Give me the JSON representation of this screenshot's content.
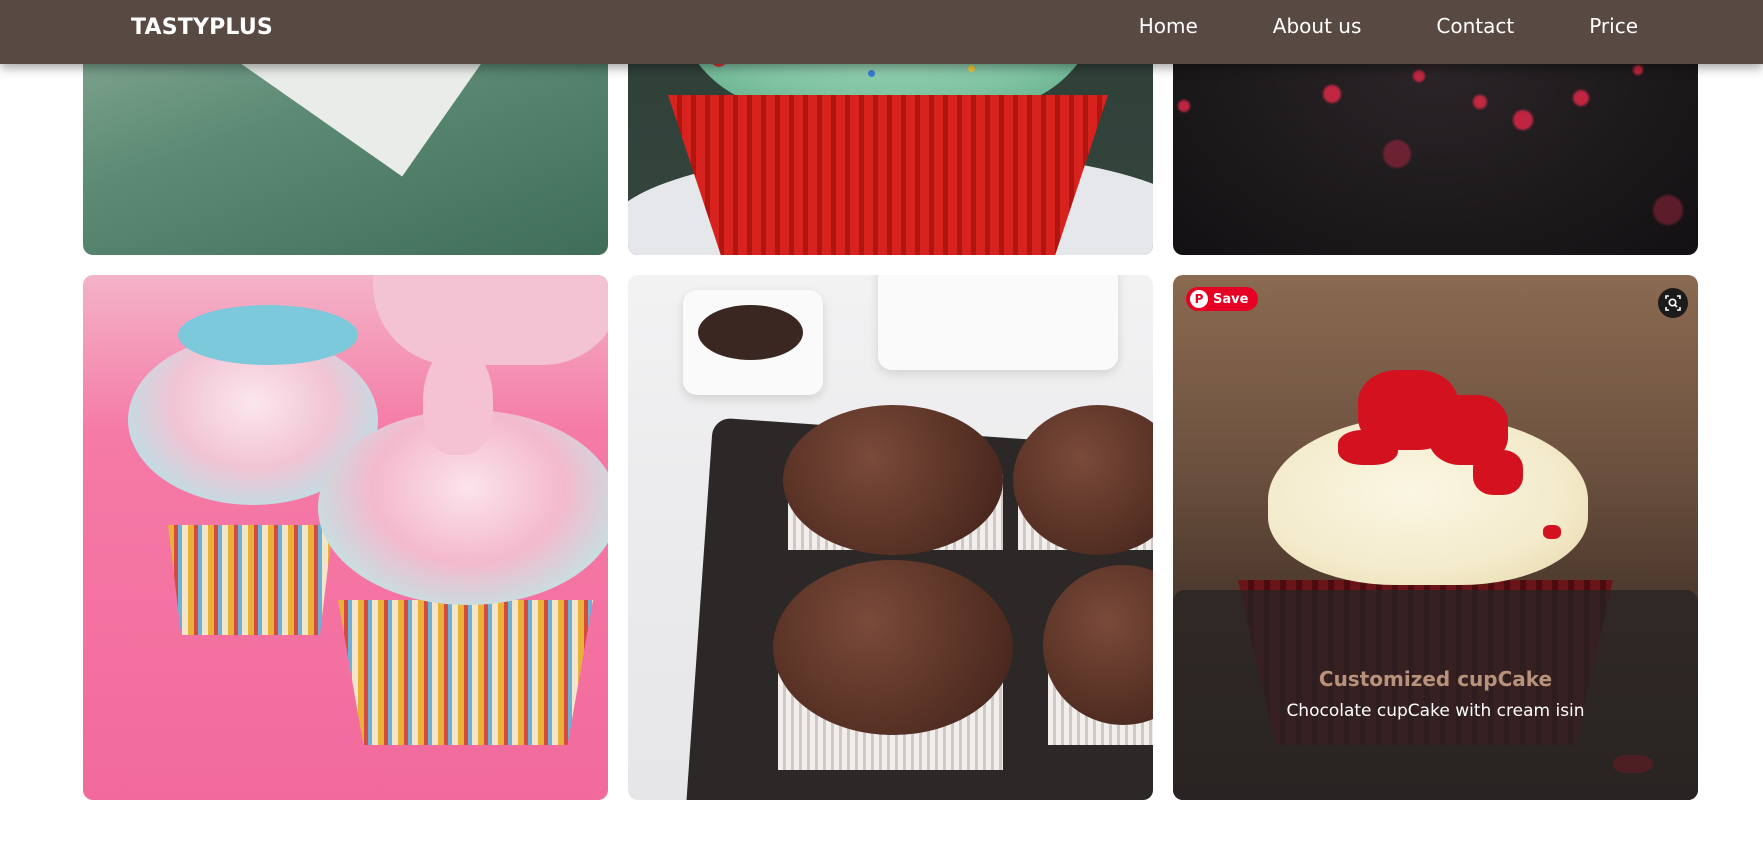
{
  "header": {
    "brand": "TASTYPLUS",
    "nav": [
      {
        "label": "Home"
      },
      {
        "label": "About us"
      },
      {
        "label": "Contact"
      },
      {
        "label": "Price"
      }
    ]
  },
  "gallery": {
    "row1": [
      {
        "image": "cupcake-on-green-paper"
      },
      {
        "image": "green-frosting-red-cupcake"
      },
      {
        "image": "red-sprinkles-bokeh"
      }
    ],
    "row2": [
      {
        "image": "pink-swirl-cupcakes"
      },
      {
        "image": "chocolate-muffins-tray"
      },
      {
        "image": "red-velvet-cupcake"
      }
    ],
    "hover_card": {
      "save_label": "Save",
      "pin_logo": "P",
      "title": "Customized cupCake",
      "description": "Chocolate cupCake with cream isin"
    }
  },
  "icons": {
    "pinterest": "pinterest-logo-icon",
    "lens": "visual-search-icon"
  },
  "colors": {
    "header_bg": "#594943",
    "overlay_title": "#b8927a",
    "pinterest_red": "#e60023"
  }
}
